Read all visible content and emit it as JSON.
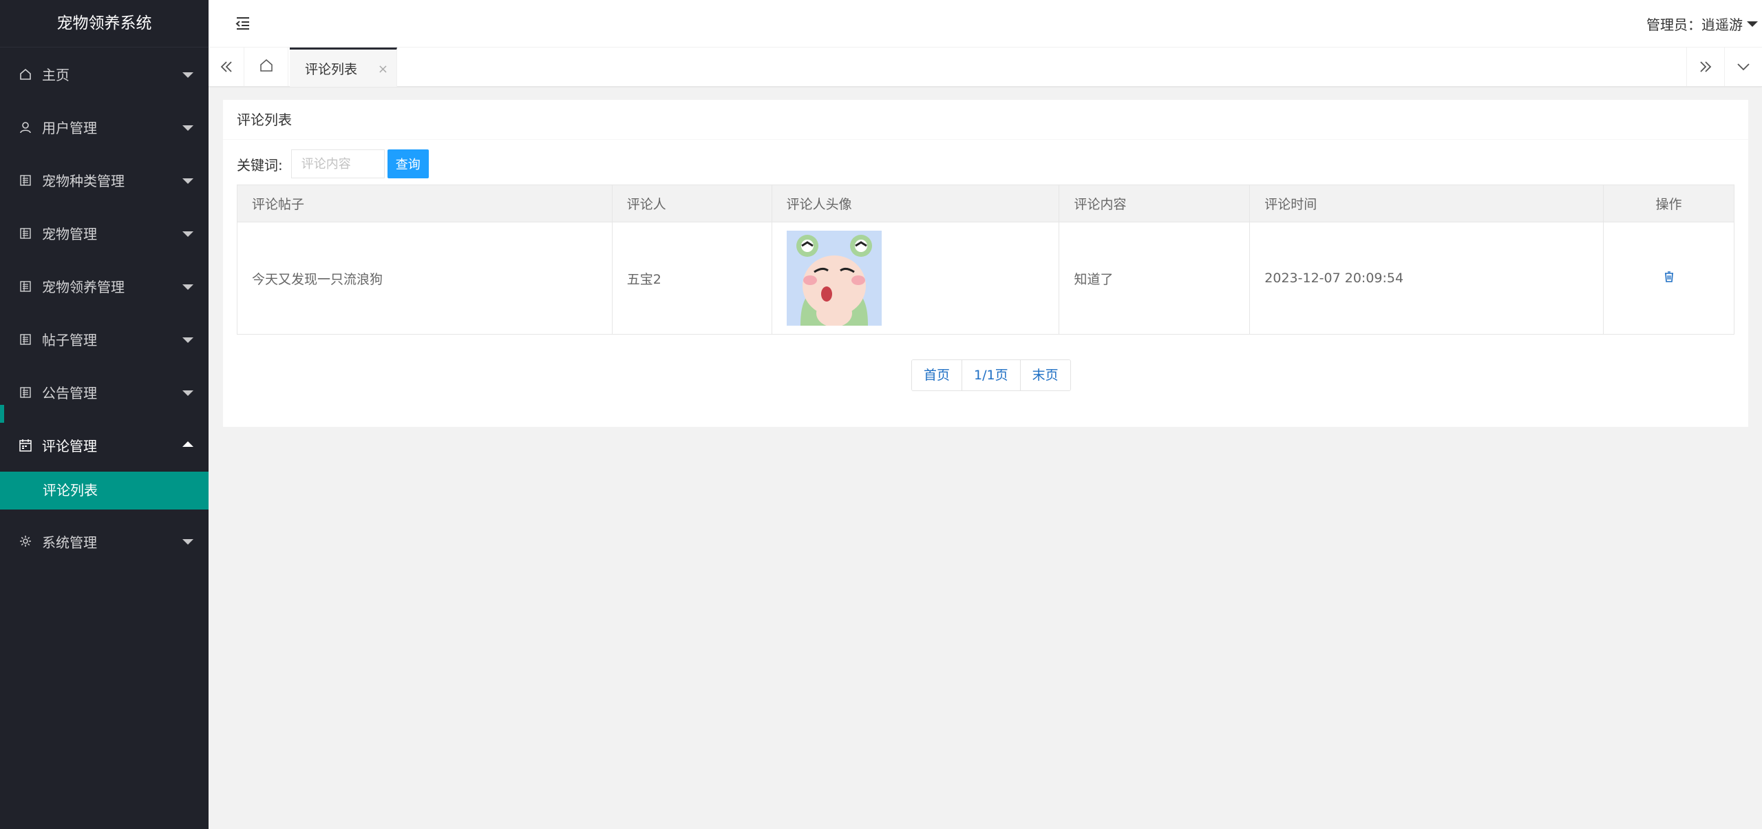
{
  "app": {
    "title": "宠物领养系统"
  },
  "sidebar": {
    "items": [
      {
        "label": "主页",
        "icon": "home-icon"
      },
      {
        "label": "用户管理",
        "icon": "user-icon"
      },
      {
        "label": "宠物种类管理",
        "icon": "list-icon"
      },
      {
        "label": "宠物管理",
        "icon": "list-icon"
      },
      {
        "label": "宠物领养管理",
        "icon": "list-icon"
      },
      {
        "label": "帖子管理",
        "icon": "list-icon"
      },
      {
        "label": "公告管理",
        "icon": "list-icon"
      },
      {
        "label": "评论管理",
        "icon": "calendar-icon",
        "open": true
      },
      {
        "label": "系统管理",
        "icon": "gear-icon"
      }
    ],
    "sub_item": "评论列表"
  },
  "header": {
    "user": "管理员：逍遥游"
  },
  "tabs": {
    "active": "评论列表",
    "close": "×"
  },
  "card": {
    "title": "评论列表",
    "search": {
      "label": "关键词:",
      "placeholder": "评论内容",
      "button": "查询"
    },
    "table": {
      "headers": [
        "评论帖子",
        "评论人",
        "评论人头像",
        "评论内容",
        "评论时间",
        "操作"
      ],
      "rows": [
        {
          "post": "今天又发现一只流浪狗",
          "user": "五宝2",
          "content": "知道了",
          "time": "2023-12-07 20:09:54"
        }
      ]
    },
    "pager": {
      "first": "首页",
      "current": "1/1页",
      "last": "末页"
    }
  },
  "colors": {
    "sidebar": "#20222a",
    "accent": "#009688",
    "primary_button": "#1e9fff"
  }
}
